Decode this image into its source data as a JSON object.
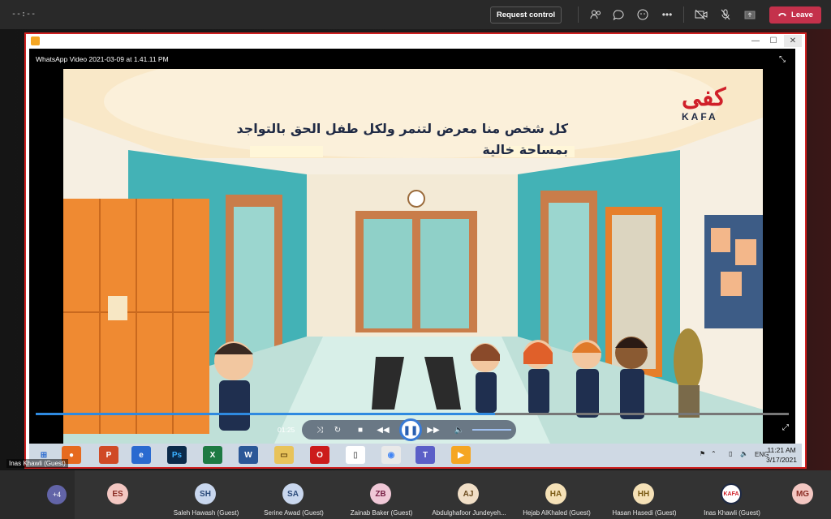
{
  "meeting": {
    "timer": "--:--",
    "request_control": "Request control",
    "leave": "Leave"
  },
  "player": {
    "video_name": "WhatsApp Video 2021-03-09 at 1.41.11 PM",
    "current_time": "01:25",
    "progress": 0.61
  },
  "video_overlay": {
    "line1": "كل شخص منا معرض لتنمر ولكل طفل الحق بالتواجد",
    "line2": "بمساحة خالية",
    "logo_mark": "كفى",
    "logo_text": "KAFA"
  },
  "taskbar": {
    "apps": [
      "start",
      "firefox",
      "powerpoint",
      "edge",
      "photoshop",
      "excel",
      "word",
      "explorer",
      "opera",
      "notes",
      "chrome",
      "teams",
      "media-player"
    ],
    "language": "ENG",
    "time": "11:21 AM",
    "date": "3/17/2021"
  },
  "presenter_label": "Inas Khawli (Guest)",
  "participants": {
    "more_count": "+4",
    "list": [
      {
        "initials": "ES",
        "name": "",
        "color": "#f3c7c2",
        "text": "#8a2c24"
      },
      {
        "initials": "SH",
        "name": "Saleh Hawash (Guest)",
        "color": "#c9d7ee",
        "text": "#2b4a7a"
      },
      {
        "initials": "SA",
        "name": "Serine Awad (Guest)",
        "color": "#c9d7ee",
        "text": "#2b4a7a"
      },
      {
        "initials": "ZB",
        "name": "Zainab Baker (Guest)",
        "color": "#f0c8d7",
        "text": "#7a2348"
      },
      {
        "initials": "AJ",
        "name": "Abdulghafoor Jundeyeh...",
        "color": "#f1dfc7",
        "text": "#6a4a1c"
      },
      {
        "initials": "HA",
        "name": "Hejab AlKhaled (Guest)",
        "color": "#f5e1b7",
        "text": "#7a5a14"
      },
      {
        "initials": "HH",
        "name": "Hasan Hasedi (Guest)",
        "color": "#f5e1b7",
        "text": "#7a5a14"
      },
      {
        "initials": "",
        "name": "Inas Khawli (Guest)",
        "color": "#ffffff",
        "text": "#d0202a"
      },
      {
        "initials": "MG",
        "name": "",
        "color": "#f3c7c2",
        "text": "#8a2c24"
      }
    ]
  },
  "colors": {
    "leave": "#c4314b",
    "share_border": "#d02020",
    "accent": "#2f8ae0"
  }
}
